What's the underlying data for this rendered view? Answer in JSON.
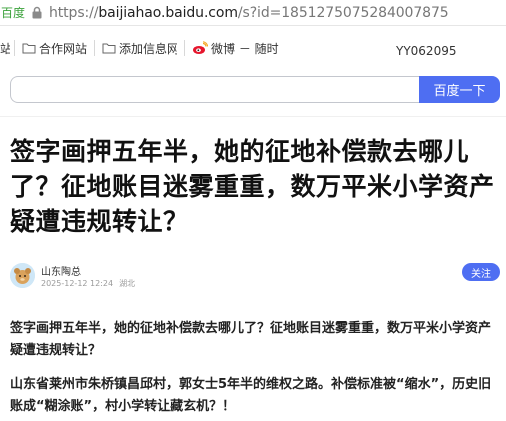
{
  "browser": {
    "tab_stub": "百度",
    "url_prefix": "https://",
    "url_host": "baijiahao.baidu.com",
    "url_path": "/s?id=1851275075284007875"
  },
  "bookmarks": {
    "stub": "站",
    "items": [
      "合作网站",
      "添加信息网",
      "微博 － 随时"
    ],
    "code": "YY062095"
  },
  "search": {
    "value": "",
    "button_label": "百度一下"
  },
  "article": {
    "title": "签字画押五年半，她的征地补偿款去哪儿了？征地账目迷雾重重，数万平米小学资产疑遭违规转让？",
    "author": "山东陶总",
    "date": "2025-12-12 12:24",
    "region": "湖北",
    "follow_label": "关注",
    "paragraphs": [
      "签字画押五年半，她的征地补偿款去哪儿了？征地账目迷雾重重，数万平米小学资产疑遭违规转让？",
      "山东省莱州市朱桥镇昌邱村，郭女士5年半的维权之路。补偿标准被“缩水”，历史旧账成“糊涂账”，村小学转让藏玄机？！"
    ]
  },
  "colors": {
    "brand_blue": "#4e6ef2",
    "tab_green": "#3aa13a",
    "weibo_red": "#e6162d"
  }
}
